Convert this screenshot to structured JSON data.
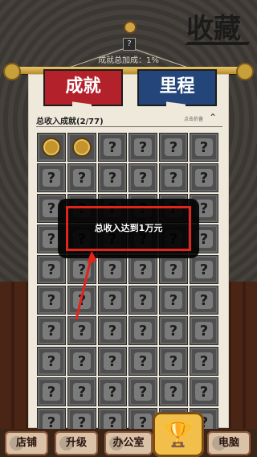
{
  "screen": {
    "title": "收藏",
    "bonus_text": "成就总加成：1%",
    "tabs": [
      {
        "label": "成就",
        "active": true
      },
      {
        "label": "里程",
        "active": false
      }
    ],
    "section": {
      "title": "总收入成就(2/77)",
      "toggle_text": "点击折叠",
      "toggle_icon": "chevron-up-icon"
    },
    "grid": {
      "columns": 6,
      "rows": 10,
      "items": [
        {
          "type": "coin"
        },
        {
          "type": "coin"
        },
        {
          "type": "q"
        },
        {
          "type": "q"
        },
        {
          "type": "q"
        },
        {
          "type": "q"
        },
        {
          "type": "q"
        },
        {
          "type": "q"
        },
        {
          "type": "q"
        },
        {
          "type": "q"
        },
        {
          "type": "q"
        },
        {
          "type": "q"
        },
        {
          "type": "q"
        },
        {
          "type": "q"
        },
        {
          "type": "q"
        },
        {
          "type": "q"
        },
        {
          "type": "q"
        },
        {
          "type": "q"
        },
        {
          "type": "q"
        },
        {
          "type": "q"
        },
        {
          "type": "q"
        },
        {
          "type": "q"
        },
        {
          "type": "q"
        },
        {
          "type": "q"
        },
        {
          "type": "q"
        },
        {
          "type": "q"
        },
        {
          "type": "q"
        },
        {
          "type": "q"
        },
        {
          "type": "q"
        },
        {
          "type": "q"
        },
        {
          "type": "q"
        },
        {
          "type": "q"
        },
        {
          "type": "q"
        },
        {
          "type": "q"
        },
        {
          "type": "q"
        },
        {
          "type": "q"
        },
        {
          "type": "q"
        },
        {
          "type": "q"
        },
        {
          "type": "q"
        },
        {
          "type": "q"
        },
        {
          "type": "q"
        },
        {
          "type": "q"
        },
        {
          "type": "q"
        },
        {
          "type": "q"
        },
        {
          "type": "q"
        },
        {
          "type": "q"
        },
        {
          "type": "q"
        },
        {
          "type": "q"
        },
        {
          "type": "q"
        },
        {
          "type": "q"
        },
        {
          "type": "q"
        },
        {
          "type": "q"
        },
        {
          "type": "q"
        },
        {
          "type": "q"
        },
        {
          "type": "q"
        },
        {
          "type": "q"
        },
        {
          "type": "q"
        },
        {
          "type": "q"
        },
        {
          "type": "q"
        },
        {
          "type": "q"
        }
      ]
    },
    "tooltip": {
      "text": "总收入达到1万元",
      "highlight_color": "#e2241c"
    },
    "bottom_nav": [
      {
        "label": "店铺",
        "icon": "shop-icon"
      },
      {
        "label": "升级",
        "icon": "upgrade-icon"
      },
      {
        "label": "办公室",
        "icon": "office-icon"
      },
      {
        "label": "收藏",
        "icon": "trophy-icon",
        "active": true
      },
      {
        "label": "电脑",
        "icon": "computer-icon"
      }
    ]
  }
}
